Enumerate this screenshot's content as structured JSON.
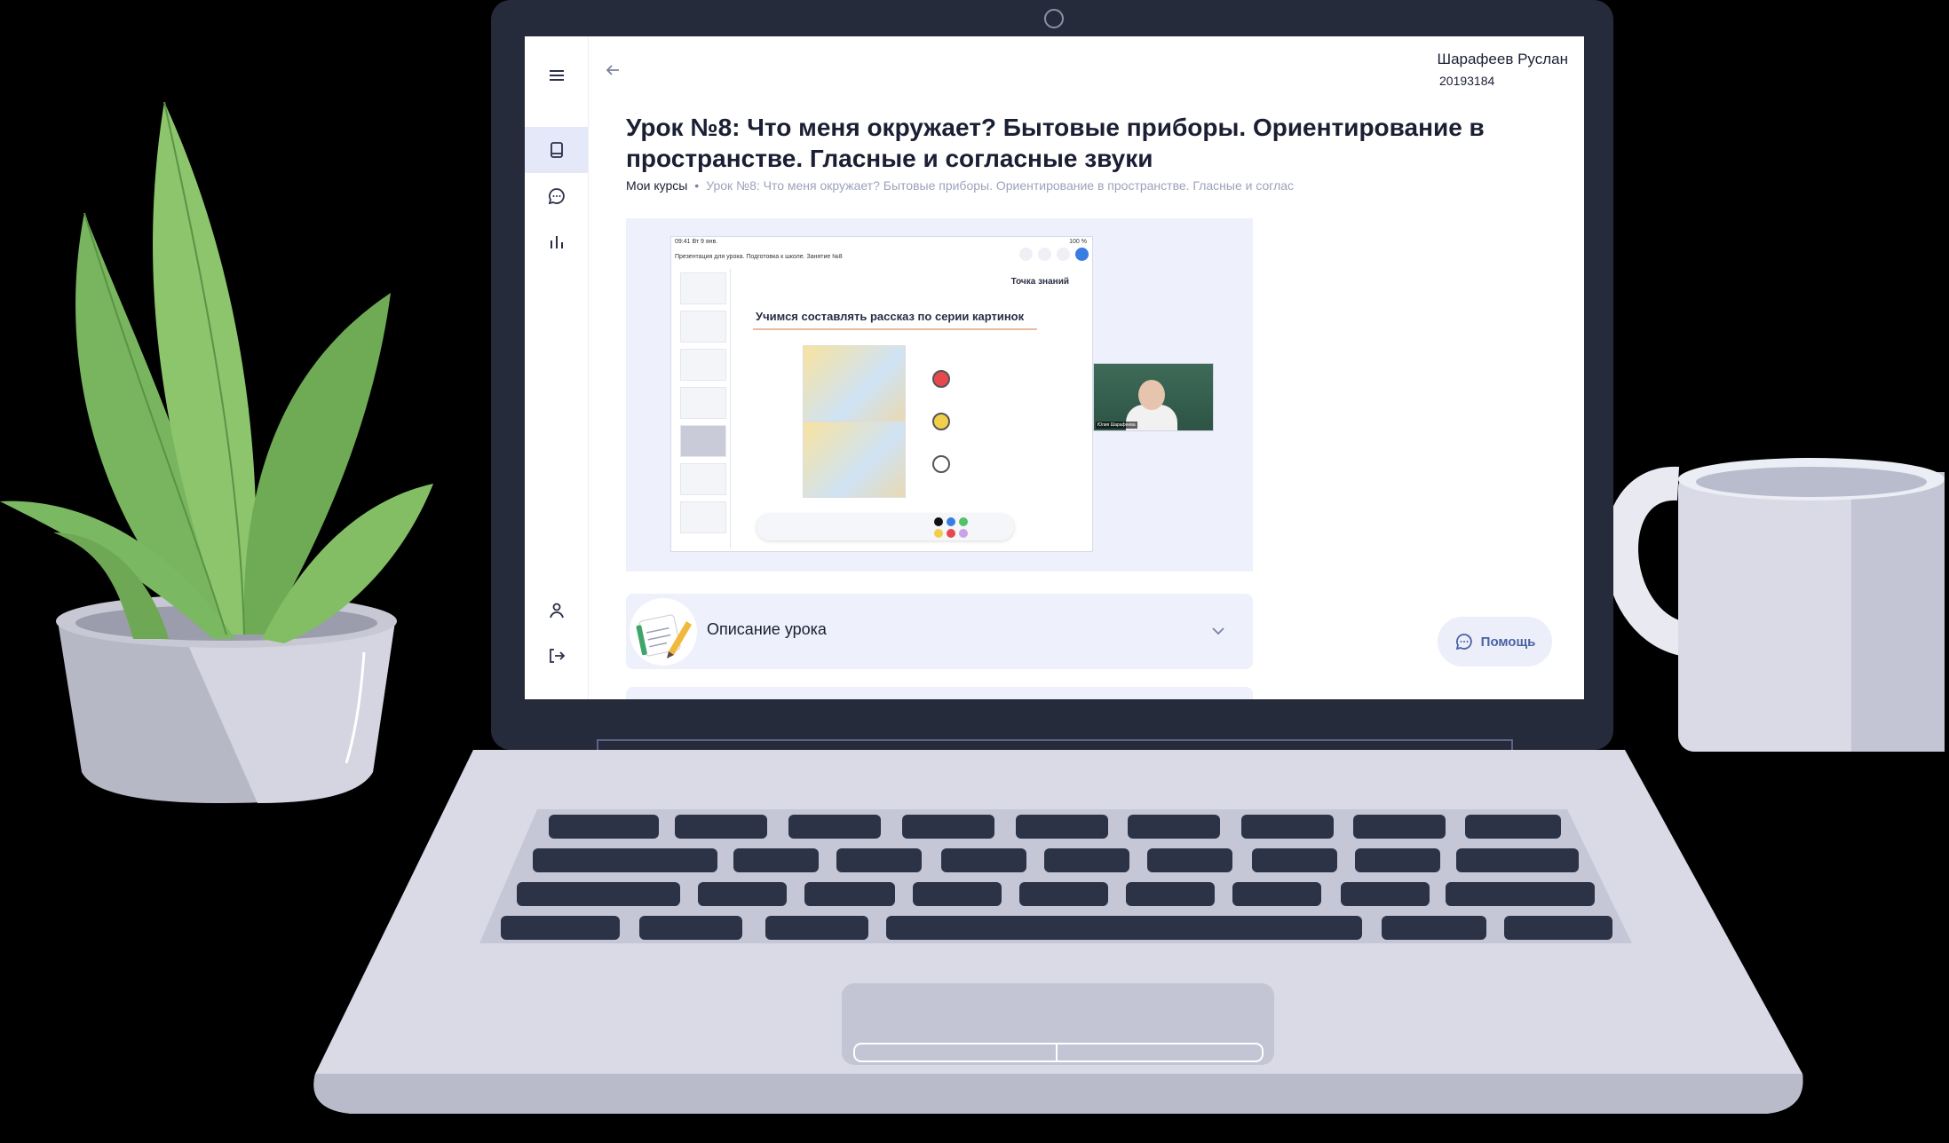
{
  "user": {
    "name": "Шарафеев Руслан",
    "id": "20193184"
  },
  "lesson": {
    "title": "Урок №8: Что меня окружает? Бытовые приборы. Ориентирование в пространстве. Гласные и согласные звуки"
  },
  "breadcrumbs": {
    "root": "Мои курсы",
    "separator": "•",
    "current": "Урок №8: Что меня окружает? Бытовые приборы. Ориентирование в пространстве. Гласные и соглас"
  },
  "video": {
    "slide_top_left": "09:41  Вт 9 янв.",
    "slide_top_right": "100 %",
    "slide_doc_title": "Презентация для урока. Подготовка к школе. Занятие №8",
    "slide_heading": "Учимся составлять рассказ по серии картинок",
    "slide_logo": "Точка знаний",
    "cam_label": "Юлия Шарафеева"
  },
  "accordion": {
    "label": "Описание урока"
  },
  "help": {
    "label": "Помощь"
  },
  "colors": {
    "accent": "#4a62a5",
    "rail_active": "#e5e8f8",
    "card_bg": "#eef0fb",
    "text": "#1b1f33",
    "muted": "#9da2bb"
  },
  "icons": {
    "menu": "menu-icon",
    "courses": "book-icon",
    "chat": "chat-icon",
    "stats": "bar-chart-icon",
    "profile": "person-icon",
    "logout": "logout-icon",
    "back": "arrow-left-icon",
    "chevron": "chevron-down-icon",
    "help": "chat-bubble-icon"
  }
}
